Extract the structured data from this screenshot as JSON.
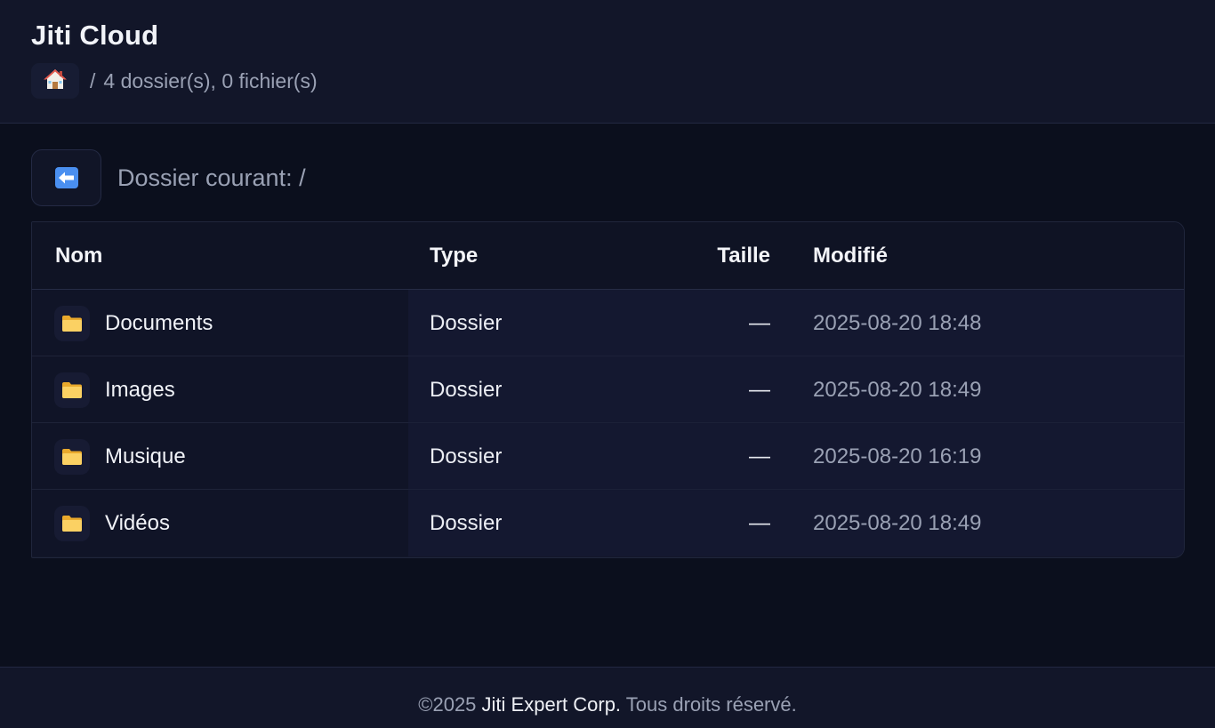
{
  "app": {
    "title": "Jiti Cloud"
  },
  "breadcrumb": {
    "home_icon": "house-icon",
    "separator": "/",
    "summary": "4 dossier(s), 0 fichier(s)"
  },
  "toolbar": {
    "back_icon": "back-arrow-icon",
    "current_folder": "Dossier courant: /"
  },
  "table": {
    "headers": {
      "name": "Nom",
      "type": "Type",
      "size": "Taille",
      "modified": "Modifié"
    },
    "rows": [
      {
        "name": "Documents",
        "type": "Dossier",
        "size": "—",
        "modified": "2025-08-20 18:48",
        "icon": "folder-icon"
      },
      {
        "name": "Images",
        "type": "Dossier",
        "size": "—",
        "modified": "2025-08-20 18:49",
        "icon": "folder-icon"
      },
      {
        "name": "Musique",
        "type": "Dossier",
        "size": "—",
        "modified": "2025-08-20 16:19",
        "icon": "folder-icon"
      },
      {
        "name": "Vidéos",
        "type": "Dossier",
        "size": "—",
        "modified": "2025-08-20 18:49",
        "icon": "folder-icon"
      }
    ]
  },
  "footer": {
    "copyright": "©2025",
    "brand": "Jiti Expert Corp.",
    "rights": "Tous droits réservé."
  },
  "colors": {
    "background": "#0b0f1d",
    "panel": "#121629",
    "accent_blue": "#4a8ff0",
    "folder_yellow": "#f7c548",
    "muted_text": "#9aa1b4"
  }
}
